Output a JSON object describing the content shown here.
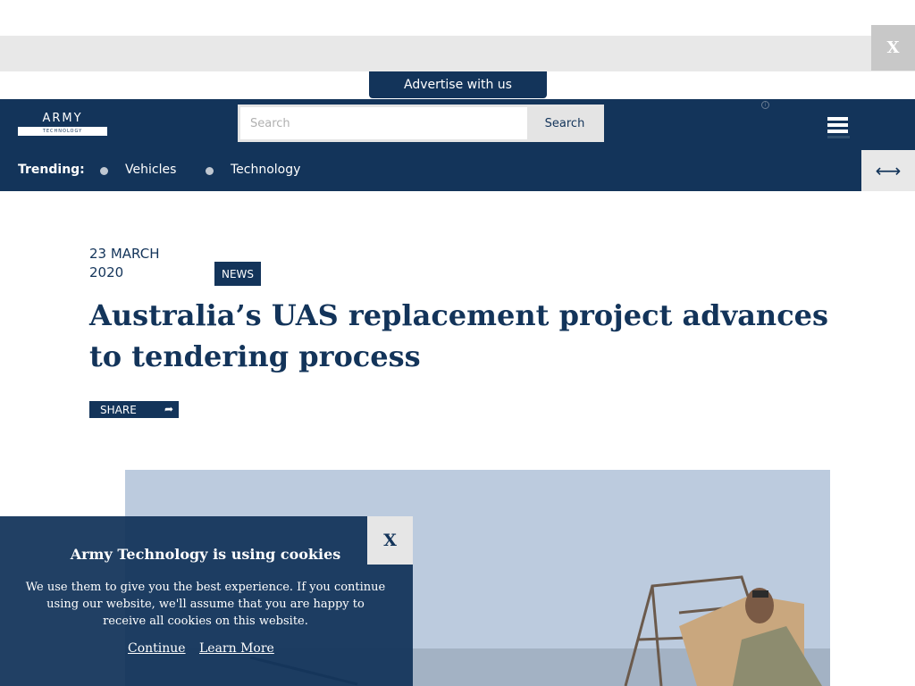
{
  "ad": {
    "close_label": "X",
    "advertise_label": "Advertise with us"
  },
  "header": {
    "logo_top": "ARMY",
    "logo_bottom": "TECHNOLOGY",
    "search_placeholder": "Search",
    "search_button": "Search",
    "info_icon": "info-icon",
    "menu_icon": "hamburger-menu-icon"
  },
  "trending": {
    "label": "Trending:",
    "items": [
      "Vehicles",
      "Technology"
    ],
    "scroll_icon": "left-right-arrow-icon"
  },
  "article": {
    "date": "23 MARCH 2020",
    "category": "NEWS",
    "title": "Australia’s UAS replacement project advances to tendering process",
    "share_label": "SHARE",
    "share_icon": "share-arrow-icon"
  },
  "cookie": {
    "close_label": "X",
    "title": "Army Technology is using cookies",
    "text": "We use them to give you the best experience. If you continue using our website, we'll assume that you are happy to receive all cookies on this website.",
    "continue_label": "Continue",
    "learn_more_label": "Learn More"
  },
  "colors": {
    "brand_navy": "#13345a",
    "ad_grey": "#e8e8e8"
  }
}
